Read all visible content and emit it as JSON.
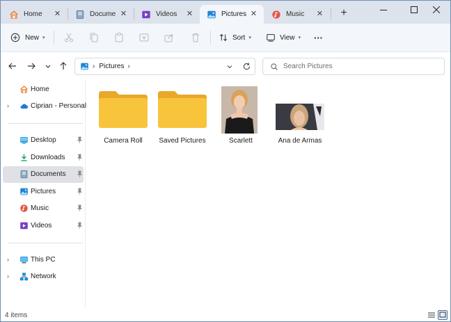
{
  "tabs": [
    {
      "label": "Home",
      "icon": "home-icon",
      "active": false
    },
    {
      "label": "Docume",
      "icon": "documents-icon",
      "active": false
    },
    {
      "label": "Videos",
      "icon": "videos-icon",
      "active": false
    },
    {
      "label": "Pictures",
      "icon": "pictures-icon",
      "active": true
    },
    {
      "label": "Music",
      "icon": "music-icon",
      "active": false
    }
  ],
  "tab_close_glyph": "✕",
  "new_tab_glyph": "+",
  "toolbar": {
    "new_label": "New",
    "sort_label": "Sort",
    "view_label": "View",
    "more_glyph": "···"
  },
  "address": {
    "location": "Pictures"
  },
  "search": {
    "placeholder": "Search Pictures"
  },
  "sidebar": {
    "items": [
      {
        "label": "Home",
        "icon": "home-icon"
      },
      {
        "label": "Ciprian - Personal",
        "icon": "onedrive-cloud-icon",
        "expandable": true
      },
      {
        "label": "Desktop",
        "icon": "desktop-icon",
        "pinned": true
      },
      {
        "label": "Downloads",
        "icon": "downloads-icon",
        "pinned": true
      },
      {
        "label": "Documents",
        "icon": "documents-icon",
        "pinned": true,
        "selected": true
      },
      {
        "label": "Pictures",
        "icon": "pictures-icon",
        "pinned": true
      },
      {
        "label": "Music",
        "icon": "music-icon",
        "pinned": true
      },
      {
        "label": "Videos",
        "icon": "videos-icon",
        "pinned": true
      },
      {
        "label": "This PC",
        "icon": "this-pc-icon",
        "expandable": true
      },
      {
        "label": "Network",
        "icon": "network-icon",
        "expandable": true
      }
    ]
  },
  "files": [
    {
      "label": "Camera Roll",
      "type": "folder"
    },
    {
      "label": "Saved Pictures",
      "type": "folder"
    },
    {
      "label": "Scarlett",
      "type": "image"
    },
    {
      "label": "Ana de Armas",
      "type": "image"
    }
  ],
  "status": {
    "item_count": "4 items"
  },
  "colors": {
    "accent": "#0067c0",
    "folder": "#f8c43c",
    "titlebar": "#dde3ec",
    "selected": "#dfe1e5"
  }
}
